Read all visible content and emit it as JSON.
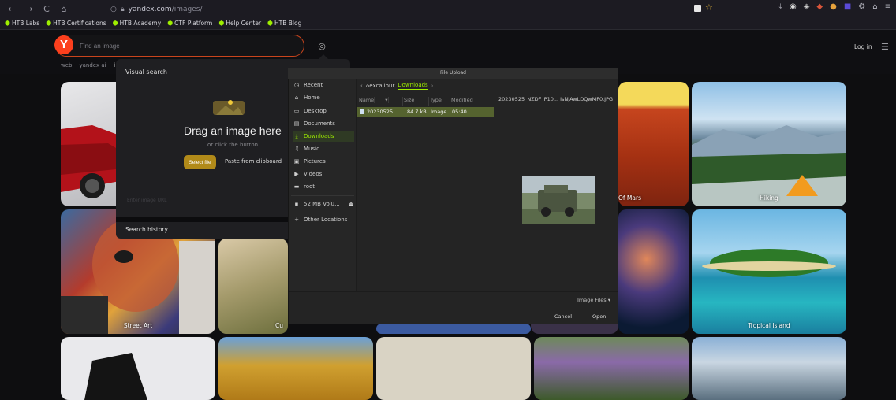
{
  "browser": {
    "nav": [
      "←",
      "→",
      "C",
      "⌂"
    ],
    "url_host": "yandex.com",
    "url_path": "/images/",
    "toolbar_icons": [
      "download-icon",
      "extension-icon",
      "extension-icon",
      "extension-icon",
      "extension-icon",
      "extension-icon",
      "settings-icon",
      "home-icon",
      "menu-icon"
    ]
  },
  "bookmarks": [
    {
      "label": "HTB Labs"
    },
    {
      "label": "HTB Certifications"
    },
    {
      "label": "HTB Academy"
    },
    {
      "label": "CTF Platform"
    },
    {
      "label": "Help Center"
    },
    {
      "label": "HTB Blog"
    }
  ],
  "header": {
    "logo": "Y",
    "search_placeholder": "Find an image",
    "services": [
      "web",
      "yandex ai",
      "i"
    ],
    "login": "Log in"
  },
  "tiles": [
    {
      "label": ""
    },
    {
      "label": ""
    },
    {
      "label": "Of Mars"
    },
    {
      "label": "Hiking"
    },
    {
      "label": "Street Art"
    },
    {
      "label": "Cu"
    },
    {
      "label": "Tropical Island"
    },
    {
      "label": ""
    }
  ],
  "visual_search": {
    "title": "Visual search",
    "drag_text": "Drag an image here",
    "or_text": "or click the button",
    "select_button": "Select file",
    "paste_button": "Paste from clipboard",
    "url_placeholder": "Enter image URL",
    "history": "Search history"
  },
  "file_dialog": {
    "title": "File Upload",
    "places": [
      {
        "label": "Recent",
        "icon": "clock-icon"
      },
      {
        "label": "Home",
        "icon": "home-icon"
      },
      {
        "label": "Desktop",
        "icon": "desktop-icon"
      },
      {
        "label": "Documents",
        "icon": "document-icon"
      },
      {
        "label": "Downloads",
        "icon": "download-icon"
      },
      {
        "label": "Music",
        "icon": "music-icon"
      },
      {
        "label": "Pictures",
        "icon": "picture-icon"
      },
      {
        "label": "Videos",
        "icon": "video-icon"
      },
      {
        "label": "root",
        "icon": "folder-icon"
      },
      {
        "label": "52 MB Volu...",
        "icon": "drive-icon"
      },
      {
        "label": "Other Locations",
        "icon": "plus-icon"
      }
    ],
    "breadcrumbs": [
      "excalibur",
      "Downloads"
    ],
    "columns": [
      "Name",
      "Size",
      "Type",
      "Modified"
    ],
    "file": {
      "name": "20230525...",
      "size": "84.7 kB",
      "type": "Image",
      "modified": "05:40"
    },
    "selected_filename": "20230525_NZDF_P10... IsNjAwLDQwMF0.JPG",
    "filter": "Image Files",
    "cancel": "Cancel",
    "open": "Open"
  }
}
